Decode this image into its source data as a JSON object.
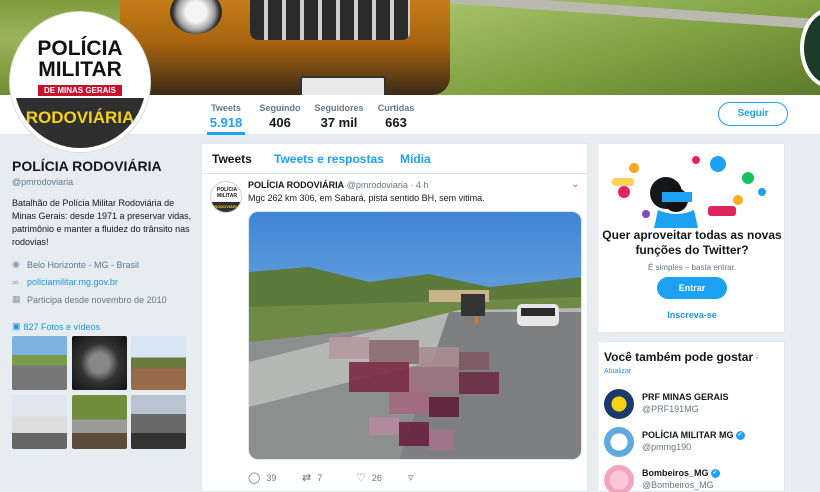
{
  "profile": {
    "logo_line1": "POLÍCIA",
    "logo_line2": "MILITAR",
    "logo_line3": "DE MINAS GERAIS",
    "logo_badge": "RODOVIÁRIA",
    "name": "POLÍCIA RODOVIÁRIA",
    "handle": "@pmrodoviaria",
    "bio": "Batalhão de Polícia Militar Rodoviária de Minas Gerais: desde 1971 a preservar vidas, patrimônio e manter a fluidez do trânsito nas rodovias!",
    "location": "Belo Horizonte - MG - Brasil",
    "website": "policiamilitar.mg.gov.br",
    "joined": "Participa desde novembro de 2010",
    "photos_link": "827 Fotos e vídeos"
  },
  "nav": {
    "stats": [
      {
        "label": "Tweets",
        "value": "5.918"
      },
      {
        "label": "Seguindo",
        "value": "406"
      },
      {
        "label": "Seguidores",
        "value": "37 mil"
      },
      {
        "label": "Curtidas",
        "value": "663"
      }
    ],
    "follow_label": "Seguir"
  },
  "timeline": {
    "tabs": [
      "Tweets",
      "Tweets e respostas",
      "Mídia"
    ],
    "tweet": {
      "name": "POLÍCIA RODOVIÁRIA",
      "handle": "@pmrodoviaria",
      "time": "· 4 h",
      "text": "Mgc 262 km 306, em Sabará,  pista sentido BH,  sem vitima.",
      "replies": "39",
      "retweets": "7",
      "likes": "26"
    }
  },
  "promo": {
    "title": "Quer aproveitar todas as novas funções do Twitter?",
    "subtitle": "É simples – basta entrar.",
    "enter_label": "Entrar",
    "signup_label": "Inscreva-se"
  },
  "suggestions": {
    "title": "Você também pode gostar",
    "refresh": "Atualizar",
    "accounts": [
      {
        "name": "PRF MINAS GERAIS",
        "handle": "@PRF191MG"
      },
      {
        "name": "POLÍCIA MILITAR MG",
        "handle": "@pmmg190"
      },
      {
        "name": "Bombeiros_MG",
        "handle": "@Bombeiros_MG"
      }
    ]
  },
  "colors": {
    "accent": "#1da1f2",
    "badge_yellow": "#f7d117",
    "logo_red": "#c8102e"
  }
}
